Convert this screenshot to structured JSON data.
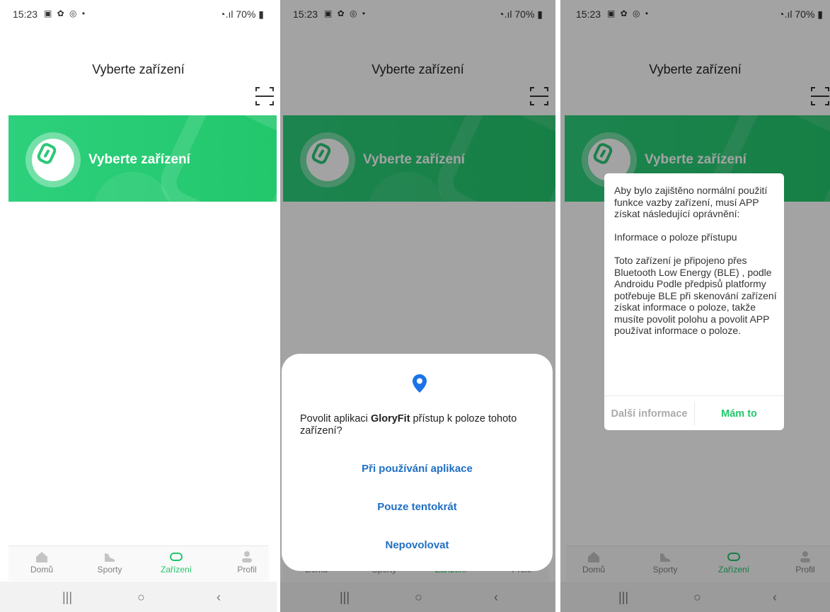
{
  "status_bar": {
    "time": "15:23",
    "battery": "70%"
  },
  "header": {
    "title": "Vyberte zařízení"
  },
  "banner": {
    "label": "Vyberte zařízení"
  },
  "tabs": [
    {
      "label": "Domů",
      "icon": "home-icon",
      "active": false
    },
    {
      "label": "Sporty",
      "icon": "shoe-icon",
      "active": false
    },
    {
      "label": "Zařízení",
      "icon": "band-icon",
      "active": true
    },
    {
      "label": "Profil",
      "icon": "person-icon",
      "active": false
    }
  ],
  "system_nav": {
    "recent": "|||",
    "home": "○",
    "back": "‹"
  },
  "permission_sheet": {
    "prompt_prefix": "Povolit aplikaci ",
    "app_name": "GloryFit",
    "prompt_suffix": " přístup k poloze tohoto zařízení?",
    "options": [
      "Při používání aplikace",
      "Pouze tentokrát",
      "Nepovolovat"
    ],
    "accent_color": "#1f6fc4"
  },
  "info_dialog": {
    "paragraph1": "Aby bylo zajištěno normální použití funkce vazby zařízení, musí APP získat následující oprávnění:",
    "paragraph2": " Informace o poloze přístupu",
    "paragraph3": " Toto zařízení je připojeno přes Bluetooth Low Energy (BLE) , podle Androidu Podle předpisů platformy potřebuje BLE při skenování zařízení získat informace o poloze, takže musíte povolit polohu a povolit APP používat informace o poloze.",
    "more_button": "Další informace",
    "ok_button": "Mám to"
  },
  "colors": {
    "brand": "#22c76c",
    "scrim": "rgba(0,0,0,0.36)"
  }
}
